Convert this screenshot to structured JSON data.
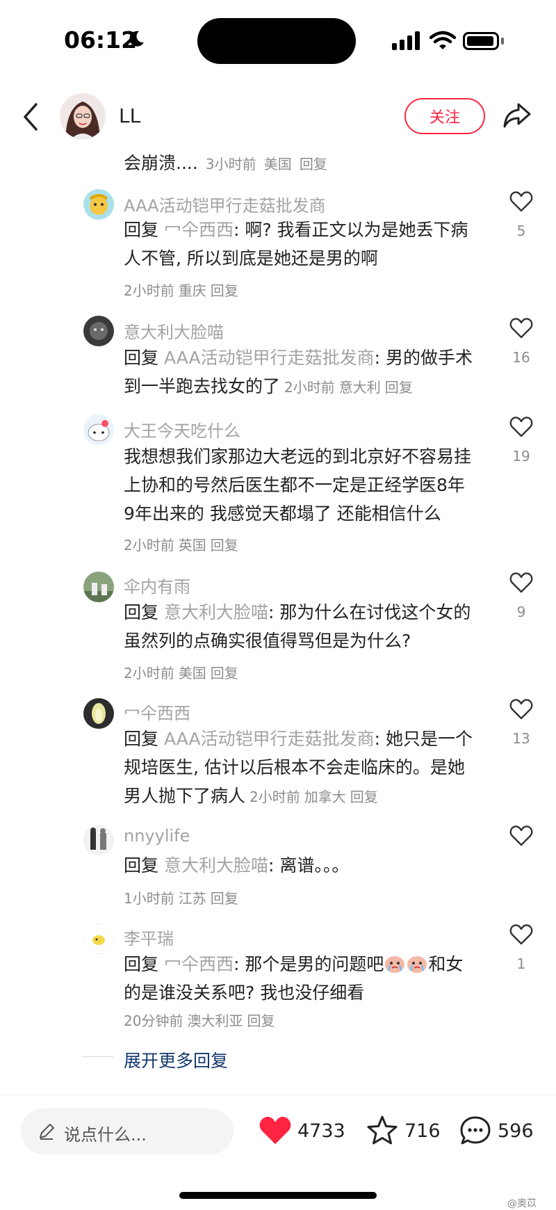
{
  "status_bar": {
    "time": "06:12"
  },
  "header": {
    "author": "LL",
    "follow_label": "关注"
  },
  "partial_comment": {
    "text": "会崩溃....",
    "time": "3小时前",
    "location": "美国",
    "reply": "回复"
  },
  "comments": [
    {
      "user": "AAA活动铠甲行走菇批发商",
      "reply_prefix": "回复 ",
      "reply_to": "冖仐西西",
      "body_l1": ": 啊? 我看正文以为是她丢下病",
      "body_l2": "人不管, 所以到底是她还是男的啊",
      "time": "2小时前",
      "location": "重庆",
      "reply": "回复",
      "likes": "5"
    },
    {
      "user": "意大利大脸喵",
      "reply_prefix": "回复 ",
      "reply_to": "AAA活动铠甲行走菇批发商",
      "body_l1": ": 男的做手术",
      "body_l2": "到一半跑去找女的了",
      "time": "2小时前",
      "location": "意大利",
      "reply": "回复",
      "likes": "16"
    },
    {
      "user": "大王今天吃什么",
      "body_l1": "我想想我们家那边大老远的到北京好不容易挂",
      "body_l2": "上协和的号然后医生都不一定是正经学医8年",
      "body_l3": "9年出来的 我感觉天都塌了 还能相信什么",
      "time": "2小时前",
      "location": "英国",
      "reply": "回复",
      "likes": "19"
    },
    {
      "user": "伞内有雨",
      "reply_prefix": "回复 ",
      "reply_to": "意大利大脸喵",
      "body_l1": ": 那为什么在讨伐这个女的",
      "body_l2": "虽然列的点确实很值得骂但是为什么?",
      "time": "2小时前",
      "location": "美国",
      "reply": "回复",
      "likes": "9"
    },
    {
      "user": "冖仐西西",
      "reply_prefix": "回复 ",
      "reply_to": "AAA活动铠甲行走菇批发商",
      "body_l1": ": 她只是一个",
      "body_l2": "规培医生, 估计以后根本不会走临床的。是她",
      "body_l3": "男人抛下了病人",
      "time": "2小时前",
      "location": "加拿大",
      "reply": "回复",
      "likes": "13"
    },
    {
      "user": "nnyylife",
      "reply_prefix": "回复 ",
      "reply_to": "意大利大脸喵",
      "body_l1": ": 离谱。。。",
      "time": "1小时前",
      "location": "江苏",
      "reply": "回复",
      "likes": ""
    },
    {
      "user": "李平瑞",
      "reply_prefix": "回复 ",
      "reply_to": "冖仐西西",
      "body_l1": ": 那个是男的问题吧",
      "body_l1b": "和女",
      "body_l2": "的是谁没关系吧? 我也没仔细看",
      "time": "20分钟前",
      "location": "澳大利亚",
      "reply": "回复",
      "likes": "1"
    }
  ],
  "expand_more": "展开更多回复",
  "bottom_bar": {
    "input_placeholder": "说点什么...",
    "likes": "4733",
    "favorites": "716",
    "comments": "596"
  },
  "watermark": "@奥苡",
  "colors": {
    "accent": "#ff2442",
    "link": "#13386c",
    "secondary_text": "#a3a3a3"
  }
}
